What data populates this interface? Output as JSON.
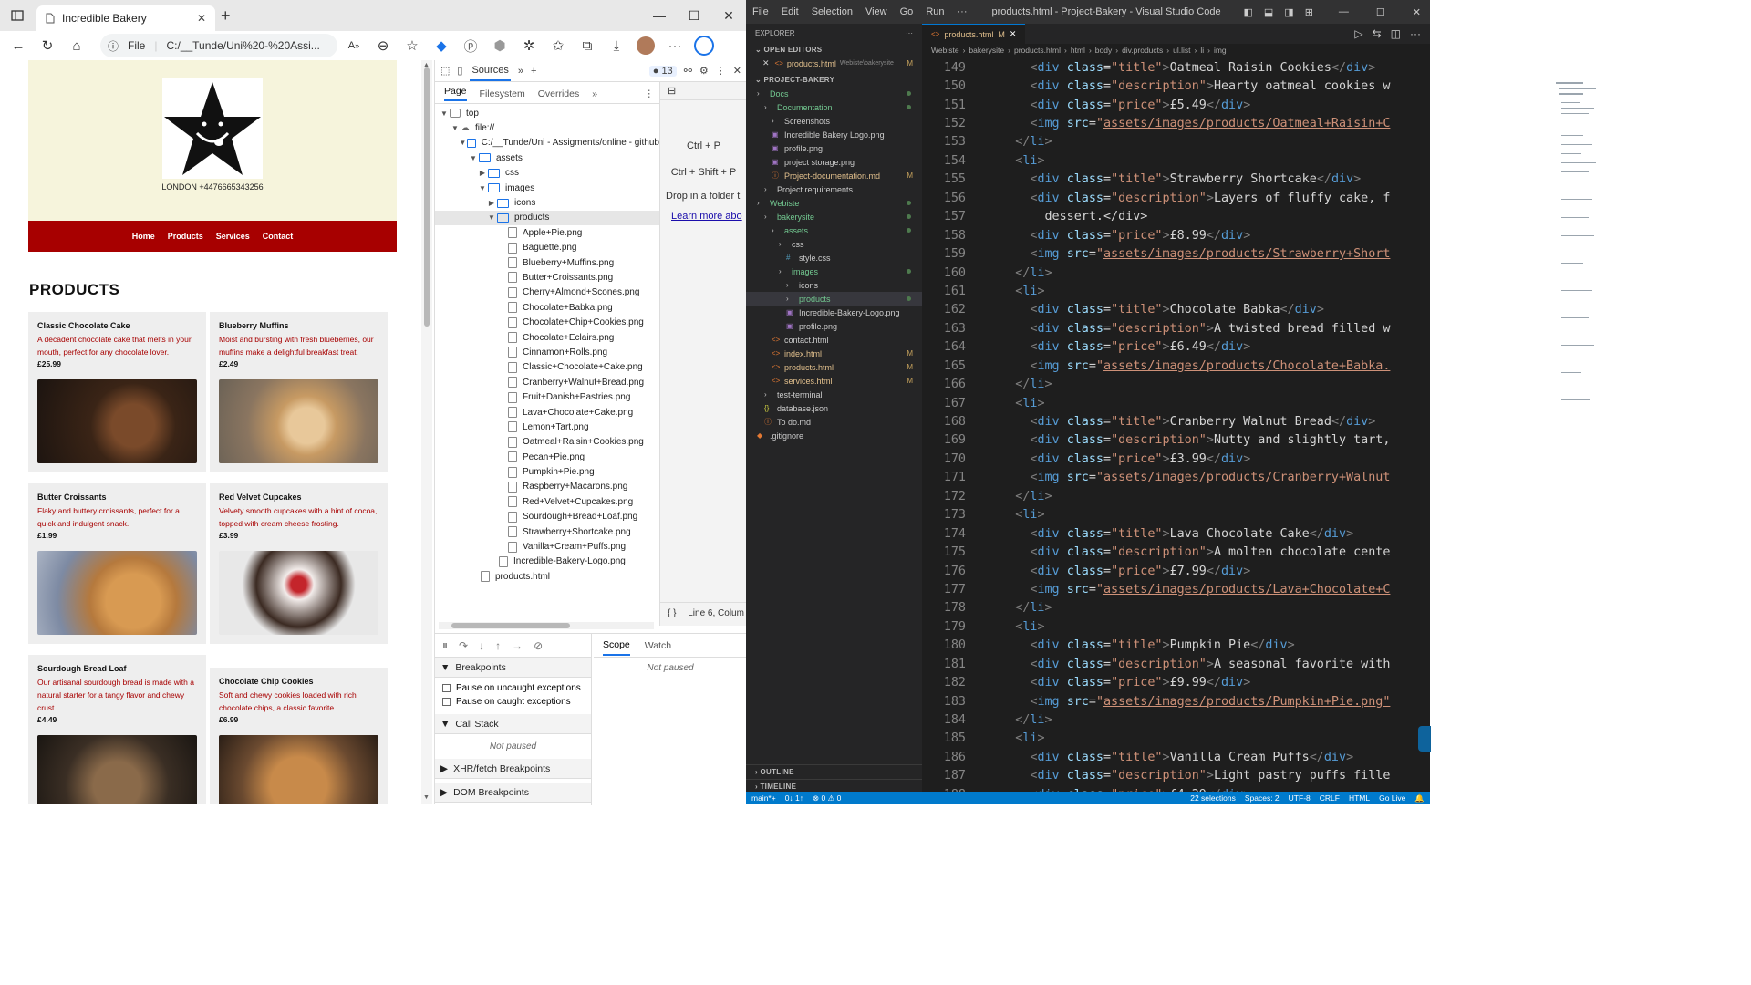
{
  "browser": {
    "tab_title": "Incredible Bakery",
    "url_prefix": "File",
    "url": "C:/__Tunde/Uni%20-%20Assi...",
    "page": {
      "phone": "LONDON +4476665343256",
      "nav": [
        "Home",
        "Products",
        "Services",
        "Contact"
      ],
      "heading": "PRODUCTS",
      "products": [
        {
          "title": "Classic Chocolate Cake",
          "description": "A decadent chocolate cake that melts in your mouth, perfect for any chocolate lover.",
          "price": "£25.99"
        },
        {
          "title": "Blueberry Muffins",
          "description": "Moist and bursting with fresh blueberries, our muffins make a delightful breakfast treat.",
          "price": "£2.49"
        },
        {
          "title": "Butter Croissants",
          "description": "Flaky and buttery croissants, perfect for a quick and indulgent snack.",
          "price": "£1.99"
        },
        {
          "title": "Red Velvet Cupcakes",
          "description": "Velvety smooth cupcakes with a hint of cocoa, topped with cream cheese frosting.",
          "price": "£3.99"
        },
        {
          "title": "Sourdough Bread Loaf",
          "description": "Our artisanal sourdough bread is made with a natural starter for a tangy flavor and chewy crust.",
          "price": "£4.49"
        },
        {
          "title": "Chocolate Chip Cookies",
          "description": "Soft and chewy cookies loaded with rich chocolate chips, a classic favorite.",
          "price": "£6.99"
        }
      ]
    },
    "devtools": {
      "tabs_sources": "Sources",
      "issues_count": "13",
      "subtabs": [
        "Page",
        "Filesystem",
        "Overrides"
      ],
      "tree_top": "top",
      "tree_file": "file://",
      "tree_path": "C:/__Tunde/Uni - Assigments/online - github",
      "tree_assets": "assets",
      "tree_css": "css",
      "tree_images": "images",
      "tree_icons": "icons",
      "tree_products": "products",
      "product_files": [
        "Apple+Pie.png",
        "Baguette.png",
        "Blueberry+Muffins.png",
        "Butter+Croissants.png",
        "Cherry+Almond+Scones.png",
        "Chocolate+Babka.png",
        "Chocolate+Chip+Cookies.png",
        "Chocolate+Eclairs.png",
        "Cinnamon+Rolls.png",
        "Classic+Chocolate+Cake.png",
        "Cranberry+Walnut+Bread.png",
        "Fruit+Danish+Pastries.png",
        "Lava+Chocolate+Cake.png",
        "Lemon+Tart.png",
        "Oatmeal+Raisin+Cookies.png",
        "Pecan+Pie.png",
        "Pumpkin+Pie.png",
        "Raspberry+Macarons.png",
        "Red+Velvet+Cupcakes.png",
        "Sourdough+Bread+Loaf.png",
        "Strawberry+Shortcake.png",
        "Vanilla+Cream+Puffs.png"
      ],
      "tree_logo": "Incredible-Bakery-Logo.png",
      "tree_products_html": "products.html",
      "hint_1": "Ctrl + P",
      "hint_2": "Ctrl + Shift + P",
      "hint_3": "Drop in a folder t",
      "hint_link": "Learn more abo",
      "line_col": "Line 6, Colum",
      "scope": "Scope",
      "watch": "Watch",
      "not_paused": "Not paused",
      "breakpoints": "Breakpoints",
      "pause_uncaught": "Pause on uncaught exceptions",
      "pause_caught": "Pause on caught exceptions",
      "call_stack": "Call Stack",
      "xhr": "XHR/fetch Breakpoints",
      "dom": "DOM Breakpoints"
    }
  },
  "vscode": {
    "menu": [
      "File",
      "Edit",
      "Selection",
      "View",
      "Go",
      "Run",
      "···"
    ],
    "title": "products.html - Project-Bakery - Visual Studio Code",
    "explorer": "EXPLORER",
    "open_editors": "OPEN EDITORS",
    "open_file": "products.html",
    "open_file_path": "Webiste\\bakerysite",
    "project": "PROJECT-BAKERY",
    "files": [
      {
        "name": "Docs",
        "indent": 0,
        "type": "folder",
        "mark": "dot"
      },
      {
        "name": "Documentation",
        "indent": 1,
        "type": "folder",
        "mark": "dot"
      },
      {
        "name": "Screenshots",
        "indent": 2,
        "type": "folder",
        "mark": ""
      },
      {
        "name": "Incredible Bakery Logo.png",
        "indent": 2,
        "type": "img",
        "mark": ""
      },
      {
        "name": "profile.png",
        "indent": 2,
        "type": "img",
        "mark": ""
      },
      {
        "name": "project storage.png",
        "indent": 2,
        "type": "img",
        "mark": ""
      },
      {
        "name": "Project-documentation.md",
        "indent": 2,
        "type": "md",
        "mark": "M"
      },
      {
        "name": "Project requirements",
        "indent": 1,
        "type": "folder",
        "mark": ""
      },
      {
        "name": "Webiste",
        "indent": 0,
        "type": "folder",
        "mark": "dot"
      },
      {
        "name": "bakerysite",
        "indent": 1,
        "type": "folder",
        "mark": "dot"
      },
      {
        "name": "assets",
        "indent": 2,
        "type": "folder",
        "mark": "dot"
      },
      {
        "name": "css",
        "indent": 3,
        "type": "folder",
        "mark": ""
      },
      {
        "name": "style.css",
        "indent": 4,
        "type": "css",
        "mark": ""
      },
      {
        "name": "images",
        "indent": 3,
        "type": "folder",
        "mark": "dot"
      },
      {
        "name": "icons",
        "indent": 4,
        "type": "folder",
        "mark": ""
      },
      {
        "name": "products",
        "indent": 4,
        "type": "folder",
        "mark": "dot"
      },
      {
        "name": "Incredible-Bakery-Logo.png",
        "indent": 4,
        "type": "img",
        "mark": ""
      },
      {
        "name": "profile.png",
        "indent": 4,
        "type": "img",
        "mark": ""
      },
      {
        "name": "contact.html",
        "indent": 2,
        "type": "html",
        "mark": ""
      },
      {
        "name": "index.html",
        "indent": 2,
        "type": "html",
        "mark": "M"
      },
      {
        "name": "products.html",
        "indent": 2,
        "type": "html",
        "mark": "M"
      },
      {
        "name": "services.html",
        "indent": 2,
        "type": "html",
        "mark": "M"
      },
      {
        "name": "test-terminal",
        "indent": 1,
        "type": "folder",
        "mark": ""
      },
      {
        "name": "database.json",
        "indent": 1,
        "type": "json",
        "mark": ""
      },
      {
        "name": "To do.md",
        "indent": 1,
        "type": "md",
        "mark": ""
      },
      {
        "name": ".gitignore",
        "indent": 0,
        "type": "git",
        "mark": ""
      }
    ],
    "outline": "OUTLINE",
    "timeline": "TIMELINE",
    "tab": "products.html",
    "tab_mark": "M",
    "breadcrumbs": [
      "Webiste",
      "bakerysite",
      "products.html",
      "html",
      "body",
      "div.products",
      "ul.list",
      "li",
      "img"
    ],
    "code_lines": [
      {
        "n": "149",
        "k": "div",
        "indent": "      ",
        "cls": "title",
        "text": "Oatmeal Raisin Cookies"
      },
      {
        "n": "150",
        "k": "div",
        "indent": "      ",
        "cls": "description",
        "text": "Hearty oatmeal cookies w"
      },
      {
        "n": "151",
        "k": "div",
        "indent": "      ",
        "cls": "price",
        "text": "£5.49"
      },
      {
        "n": "152",
        "k": "img",
        "indent": "      ",
        "src": "assets/images/products/Oatmeal+Raisin+C"
      },
      {
        "n": "153",
        "k": "close",
        "indent": "    "
      },
      {
        "n": "154",
        "k": "open",
        "indent": "    "
      },
      {
        "n": "155",
        "k": "div",
        "indent": "      ",
        "cls": "title",
        "text": "Strawberry Shortcake"
      },
      {
        "n": "156",
        "k": "div",
        "indent": "      ",
        "cls": "description",
        "text": "Layers of fluffy cake, f"
      },
      {
        "n": "157",
        "k": "plain",
        "indent": "        ",
        "text": "dessert.</div>"
      },
      {
        "n": "158",
        "k": "div",
        "indent": "      ",
        "cls": "price",
        "text": "£8.99"
      },
      {
        "n": "159",
        "k": "img",
        "indent": "      ",
        "src": "assets/images/products/Strawberry+Short"
      },
      {
        "n": "160",
        "k": "close",
        "indent": "    "
      },
      {
        "n": "161",
        "k": "open",
        "indent": "    "
      },
      {
        "n": "162",
        "k": "div",
        "indent": "      ",
        "cls": "title",
        "text": "Chocolate Babka"
      },
      {
        "n": "163",
        "k": "div",
        "indent": "      ",
        "cls": "description",
        "text": "A twisted bread filled w"
      },
      {
        "n": "164",
        "k": "div",
        "indent": "      ",
        "cls": "price",
        "text": "£6.49"
      },
      {
        "n": "165",
        "k": "img",
        "indent": "      ",
        "src": "assets/images/products/Chocolate+Babka."
      },
      {
        "n": "166",
        "k": "close",
        "indent": "    "
      },
      {
        "n": "167",
        "k": "open",
        "indent": "    "
      },
      {
        "n": "168",
        "k": "div",
        "indent": "      ",
        "cls": "title",
        "text": "Cranberry Walnut Bread"
      },
      {
        "n": "169",
        "k": "div",
        "indent": "      ",
        "cls": "description",
        "text": "Nutty and slightly tart,"
      },
      {
        "n": "170",
        "k": "div",
        "indent": "      ",
        "cls": "price",
        "text": "£3.99"
      },
      {
        "n": "171",
        "k": "img",
        "indent": "      ",
        "src": "assets/images/products/Cranberry+Walnut"
      },
      {
        "n": "172",
        "k": "close",
        "indent": "    "
      },
      {
        "n": "173",
        "k": "open",
        "indent": "    "
      },
      {
        "n": "174",
        "k": "div",
        "indent": "      ",
        "cls": "title",
        "text": "Lava Chocolate Cake"
      },
      {
        "n": "175",
        "k": "div",
        "indent": "      ",
        "cls": "description",
        "text": "A molten chocolate cente"
      },
      {
        "n": "176",
        "k": "div",
        "indent": "      ",
        "cls": "price",
        "text": "£7.99"
      },
      {
        "n": "177",
        "k": "img",
        "indent": "      ",
        "src": "assets/images/products/Lava+Chocolate+C"
      },
      {
        "n": "178",
        "k": "close",
        "indent": "    "
      },
      {
        "n": "179",
        "k": "open",
        "indent": "    "
      },
      {
        "n": "180",
        "k": "div",
        "indent": "      ",
        "cls": "title",
        "text": "Pumpkin Pie"
      },
      {
        "n": "181",
        "k": "div",
        "indent": "      ",
        "cls": "description",
        "text": "A seasonal favorite with"
      },
      {
        "n": "182",
        "k": "div",
        "indent": "      ",
        "cls": "price",
        "text": "£9.99"
      },
      {
        "n": "183",
        "k": "img",
        "indent": "      ",
        "src": "assets/images/products/Pumpkin+Pie.png\""
      },
      {
        "n": "184",
        "k": "close",
        "indent": "    "
      },
      {
        "n": "185",
        "k": "open",
        "indent": "    "
      },
      {
        "n": "186",
        "k": "div",
        "indent": "      ",
        "cls": "title",
        "text": "Vanilla Cream Puffs"
      },
      {
        "n": "187",
        "k": "div",
        "indent": "      ",
        "cls": "description",
        "text": "Light pastry puffs fille"
      },
      {
        "n": "188",
        "k": "div",
        "indent": "      ",
        "cls": "price",
        "text": "£4.29"
      }
    ],
    "status": {
      "branch": "main*+",
      "sync": "0↓ 1↑",
      "problems": "⊗ 0 ⚠ 0",
      "selections": "22 selections",
      "spaces": "Spaces: 2",
      "encoding": "UTF-8",
      "eol": "CRLF",
      "lang": "HTML",
      "live": "Go Live"
    }
  }
}
